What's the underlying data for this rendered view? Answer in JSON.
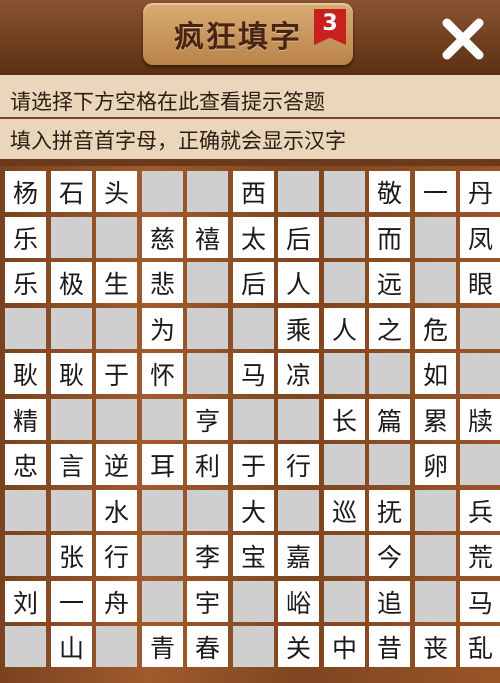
{
  "header": {
    "title": "疯狂填字",
    "level": "3",
    "close_icon": "close-icon"
  },
  "hints": {
    "line1": "请选择下方空格在此查看提示答题",
    "line2": "填入拼音首字母，正确就会显示汉字"
  },
  "colors": {
    "board_wood": "#8b4c24",
    "filled_cell": "#ffffff",
    "blank_cell": "#cfcfcf",
    "hint_panel": "#ead6bb",
    "badge": "#c8201f"
  },
  "grid": {
    "rows": 11,
    "cols": 11,
    "cells": [
      [
        "杨",
        "石",
        "头",
        null,
        null,
        "西",
        null,
        null,
        "敬",
        "一",
        "丹"
      ],
      [
        "乐",
        null,
        null,
        "慈",
        "禧",
        "太",
        "后",
        null,
        "而",
        null,
        "凤"
      ],
      [
        "乐",
        "极",
        "生",
        "悲",
        null,
        "后",
        "人",
        null,
        "远",
        null,
        "眼"
      ],
      [
        null,
        null,
        null,
        "为",
        null,
        null,
        "乘",
        "人",
        "之",
        "危",
        null
      ],
      [
        "耿",
        "耿",
        "于",
        "怀",
        null,
        "马",
        "凉",
        null,
        null,
        "如",
        null
      ],
      [
        "精",
        null,
        null,
        null,
        "亨",
        null,
        null,
        "长",
        "篇",
        "累",
        "牍"
      ],
      [
        "忠",
        "言",
        "逆",
        "耳",
        "利",
        "于",
        "行",
        null,
        null,
        "卵",
        null
      ],
      [
        null,
        null,
        "水",
        null,
        null,
        "大",
        null,
        "巡",
        "抚",
        null,
        "兵"
      ],
      [
        null,
        "张",
        "行",
        null,
        "李",
        "宝",
        "嘉",
        null,
        "今",
        null,
        "荒"
      ],
      [
        "刘",
        "一",
        "舟",
        null,
        "宇",
        null,
        "峪",
        null,
        "追",
        null,
        "马"
      ],
      [
        null,
        "山",
        null,
        "青",
        "春",
        null,
        "关",
        "中",
        "昔",
        "丧",
        "乱"
      ]
    ]
  }
}
